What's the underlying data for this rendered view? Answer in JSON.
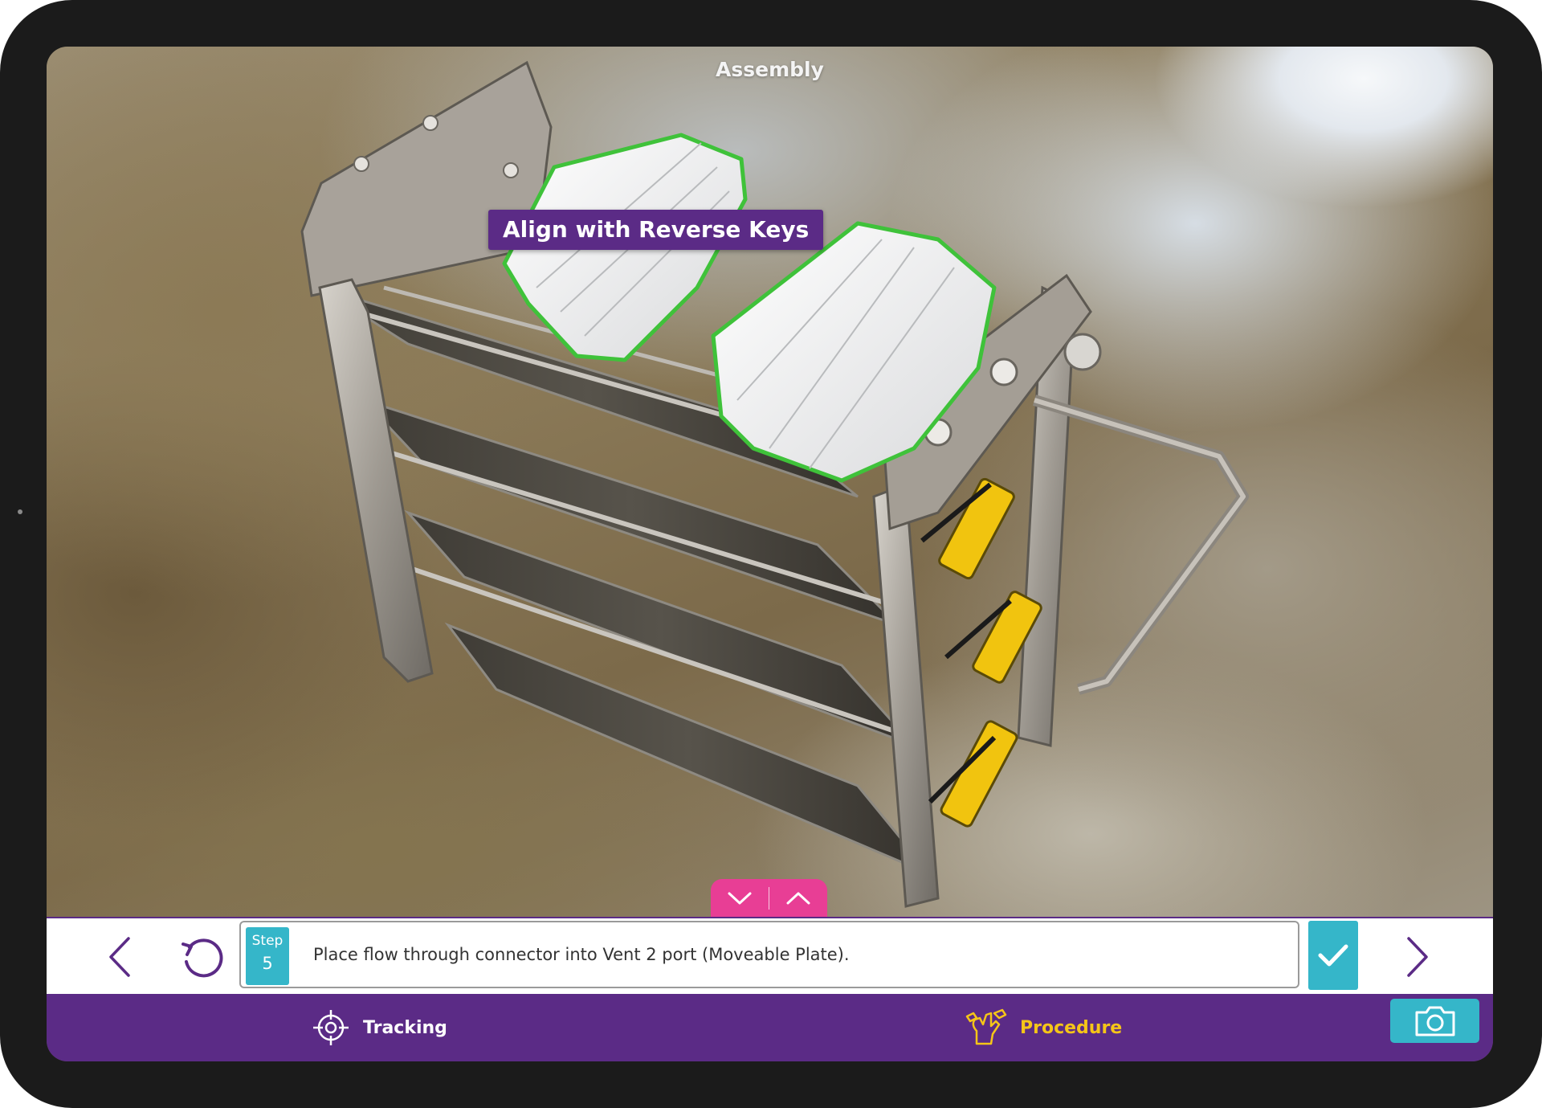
{
  "viewport": {
    "title": "Assembly",
    "callout": "Align with Reverse Keys"
  },
  "drawer_toggle": {
    "collapse_icon": "chevron-down-icon",
    "expand_icon": "chevron-up-icon",
    "color": "#e83e95"
  },
  "step": {
    "label": "Step",
    "number": "5",
    "instruction": "Place flow through connector into Vent 2 port (Moveable Plate)."
  },
  "controls": {
    "prev_icon": "chevron-left-icon",
    "reset_icon": "reset-icon",
    "confirm_icon": "checkmark-icon",
    "next_icon": "chevron-right-icon"
  },
  "tabs": [
    {
      "label": "Tracking",
      "icon": "crosshair-icon",
      "active": false
    },
    {
      "label": "Procedure",
      "icon": "wrench-hand-icon",
      "active": true
    }
  ],
  "camera": {
    "icon": "camera-icon"
  },
  "colors": {
    "brand_purple": "#5b2b86",
    "accent_teal": "#35b6c9",
    "active_yellow": "#f5c518",
    "highlight_green": "#3fc23a"
  }
}
